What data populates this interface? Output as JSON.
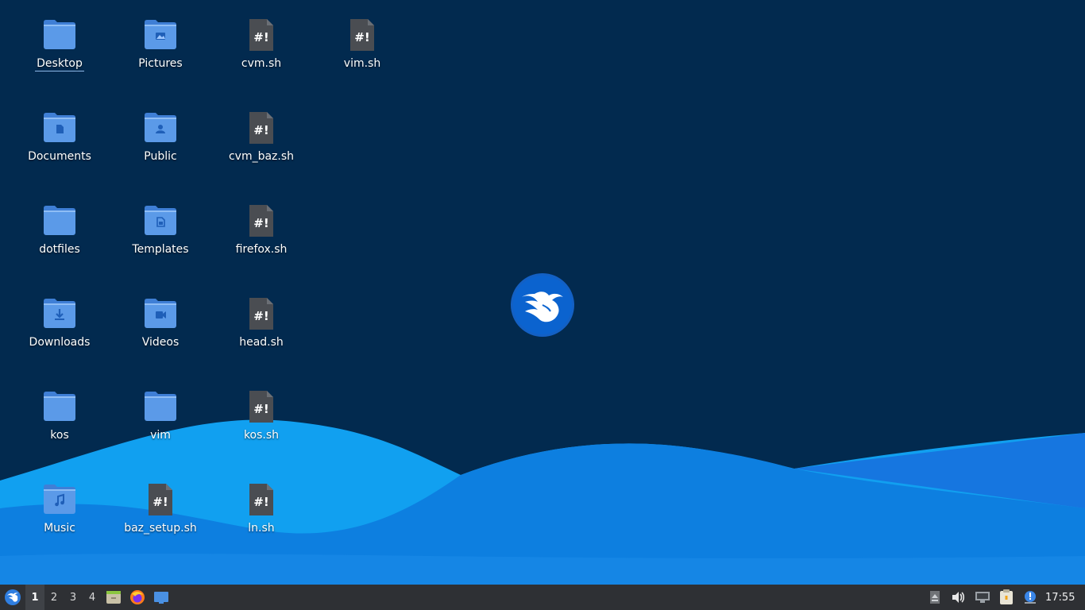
{
  "desktop": {
    "icons": [
      {
        "label": "Desktop",
        "type": "folder",
        "emblem": "none"
      },
      {
        "label": "Pictures",
        "type": "folder",
        "emblem": "image"
      },
      {
        "label": "cvm.sh",
        "type": "script"
      },
      {
        "label": "vim.sh",
        "type": "script"
      },
      {
        "label": "Documents",
        "type": "folder",
        "emblem": "document"
      },
      {
        "label": "Public",
        "type": "folder",
        "emblem": "person"
      },
      {
        "label": "cvm_baz.sh",
        "type": "script"
      },
      {
        "label": "dotfiles",
        "type": "folder",
        "emblem": "none"
      },
      {
        "label": "Templates",
        "type": "folder",
        "emblem": "template"
      },
      {
        "label": "firefox.sh",
        "type": "script"
      },
      {
        "label": "Downloads",
        "type": "folder",
        "emblem": "download"
      },
      {
        "label": "Videos",
        "type": "folder",
        "emblem": "video"
      },
      {
        "label": "head.sh",
        "type": "script"
      },
      {
        "label": "kos",
        "type": "folder",
        "emblem": "none"
      },
      {
        "label": "vim",
        "type": "folder",
        "emblem": "none"
      },
      {
        "label": "kos.sh",
        "type": "script"
      },
      {
        "label": "Music",
        "type": "folder",
        "emblem": "music"
      },
      {
        "label": "baz_setup.sh",
        "type": "script"
      },
      {
        "label": "ln.sh",
        "type": "script"
      }
    ],
    "script_glyph": "#!",
    "logo_icon": "hummingbird-logo-icon"
  },
  "taskbar": {
    "start_icon": "hummingbird-start-icon",
    "workspaces": [
      "1",
      "2",
      "3",
      "4"
    ],
    "active_workspace": "1",
    "launchers": [
      "file-manager-icon",
      "firefox-icon",
      "show-desktop-icon"
    ],
    "tray": [
      "eject-icon",
      "volume-icon",
      "network-icon",
      "clipboard-icon",
      "notification-icon"
    ],
    "clock": "17:55"
  },
  "colors": {
    "background": "#022a4f",
    "folder": "#5b9ae8",
    "script": "#4a4d52",
    "wave_light": "#1aa3f0",
    "wave_mid": "#0f86e3",
    "taskbar": "#2e3034"
  }
}
